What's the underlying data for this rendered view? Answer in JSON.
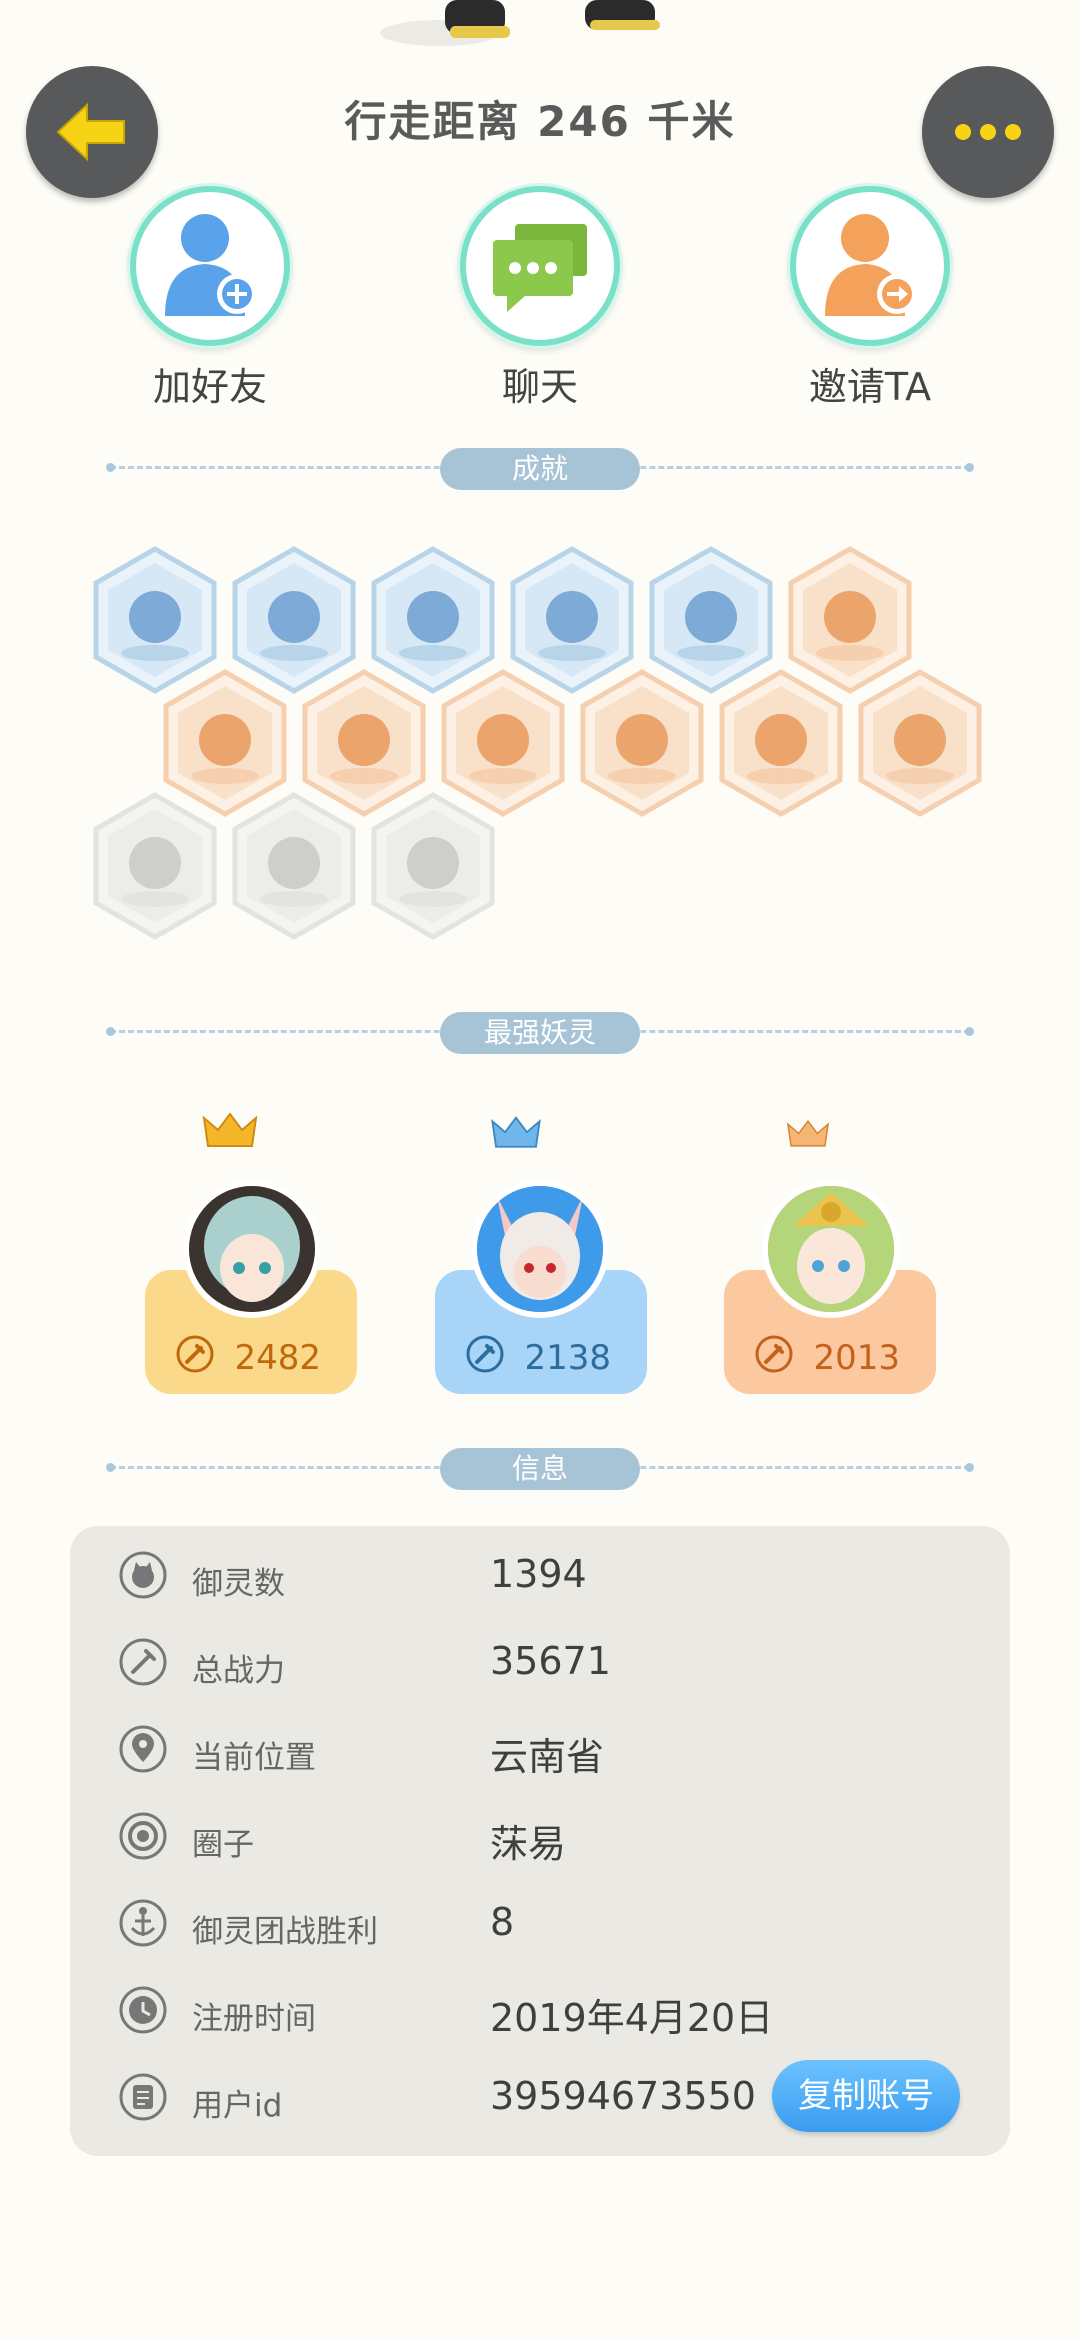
{
  "header": {
    "title": "行走距离 246 千米",
    "back_icon": "back-arrow-icon",
    "more_icon": "more-dots-icon"
  },
  "actions": [
    {
      "label": "加好友",
      "icon": "add-friend-icon"
    },
    {
      "label": "聊天",
      "icon": "chat-icon"
    },
    {
      "label": "邀请TA",
      "icon": "invite-icon"
    }
  ],
  "sections": {
    "achievements": "成就",
    "strongest": "最强妖灵",
    "info": "信息"
  },
  "achievements": [
    {
      "icon": "sneaker-badge-icon",
      "tier": "blue"
    },
    {
      "icon": "magnifier-badge-icon",
      "tier": "blue"
    },
    {
      "icon": "cat-spirit-badge-icon",
      "tier": "blue"
    },
    {
      "icon": "fox-spirit-badge-icon",
      "tier": "blue"
    },
    {
      "icon": "yinyang-book-badge-icon",
      "tier": "blue"
    },
    {
      "icon": "moon-badge-icon",
      "tier": "orange"
    },
    {
      "icon": "gourd-badge-icon",
      "tier": "orange"
    },
    {
      "icon": "crystal-badge-icon",
      "tier": "orange"
    },
    {
      "icon": "yinyang-wave-badge-icon",
      "tier": "orange"
    },
    {
      "icon": "monkey-badge-icon",
      "tier": "orange"
    },
    {
      "icon": "cart-cat-badge-icon",
      "tier": "orange"
    },
    {
      "icon": "scroll-badge-icon",
      "tier": "orange"
    },
    {
      "icon": "dragon-badge-icon",
      "tier": "locked"
    },
    {
      "icon": "demon-badge-icon",
      "tier": "locked"
    },
    {
      "icon": "book-cat-badge-icon",
      "tier": "locked"
    }
  ],
  "spirits": [
    {
      "power": "2482",
      "color": "#fbd98a",
      "text": "#c2680c"
    },
    {
      "power": "2138",
      "color": "#a8d4f7",
      "text": "#2c6d9e"
    },
    {
      "power": "2013",
      "color": "#fcc8a0",
      "text": "#c4611b"
    }
  ],
  "info": [
    {
      "key": "御灵数",
      "value": "1394",
      "icon": "spirit-count-icon"
    },
    {
      "key": "总战力",
      "value": "35671",
      "icon": "sword-icon"
    },
    {
      "key": "当前位置",
      "value": "云南省",
      "icon": "location-pin-icon"
    },
    {
      "key": "圈子",
      "value": "莯易",
      "icon": "circle-target-icon"
    },
    {
      "key": "御灵团战胜利",
      "value": "8",
      "icon": "anchor-icon"
    },
    {
      "key": "注册时间",
      "value": "2019年4月20日",
      "icon": "clock-icon"
    },
    {
      "key": "用户id",
      "value": "39594673550",
      "icon": "id-card-icon"
    }
  ],
  "copy_button": "复制账号"
}
